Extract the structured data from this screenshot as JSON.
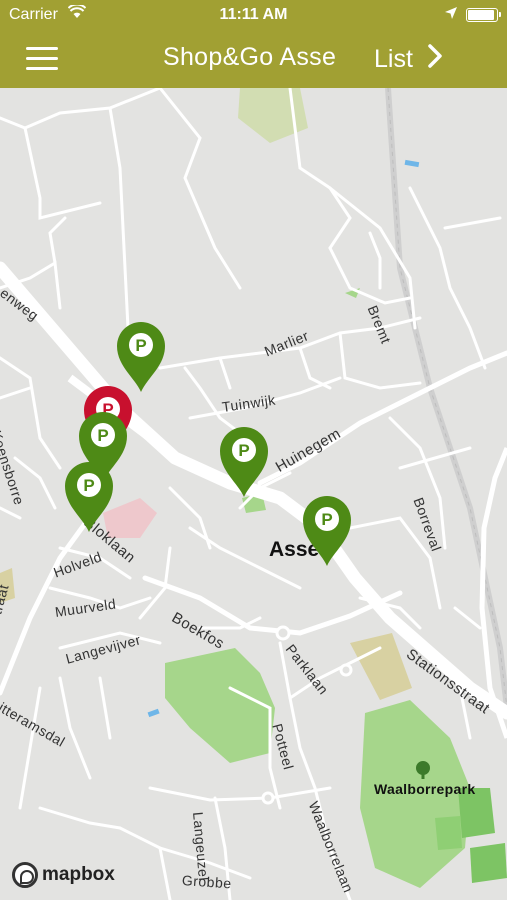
{
  "status_bar": {
    "carrier": "Carrier",
    "time": "11:11 AM"
  },
  "navbar": {
    "title": "Shop&Go Asse",
    "list_label": "List"
  },
  "map": {
    "city_label": "Asse",
    "park_label": "Waalborrepark",
    "attribution": "mapbox",
    "streets": {
      "s1": "enweg",
      "s2": "Koensborre",
      "s3": "Marlier",
      "s4": "Tuinwijk",
      "s5": "Huinegem",
      "s6": "Bremt",
      "s7": "Borreval",
      "s8": "Bloklaan",
      "s9": "Holveld",
      "s10": "Muurveld",
      "s11": "Boekfos",
      "s12": "Langevijver",
      "s13": "Parklaan",
      "s14": "Stationsstraat",
      "s15": "Potteel",
      "s16": "Langeuzel",
      "s17": "Waalborrelaan",
      "s18": "Grobbe",
      "s19": "itteramsdal",
      "s20": "traat"
    },
    "colors": {
      "header": "#a1a033",
      "map_bg": "#e3e3e1",
      "road": "#ffffff",
      "park": "#a6d68b",
      "marker_available": "#4e8a16",
      "marker_full": "#c8102e"
    }
  }
}
